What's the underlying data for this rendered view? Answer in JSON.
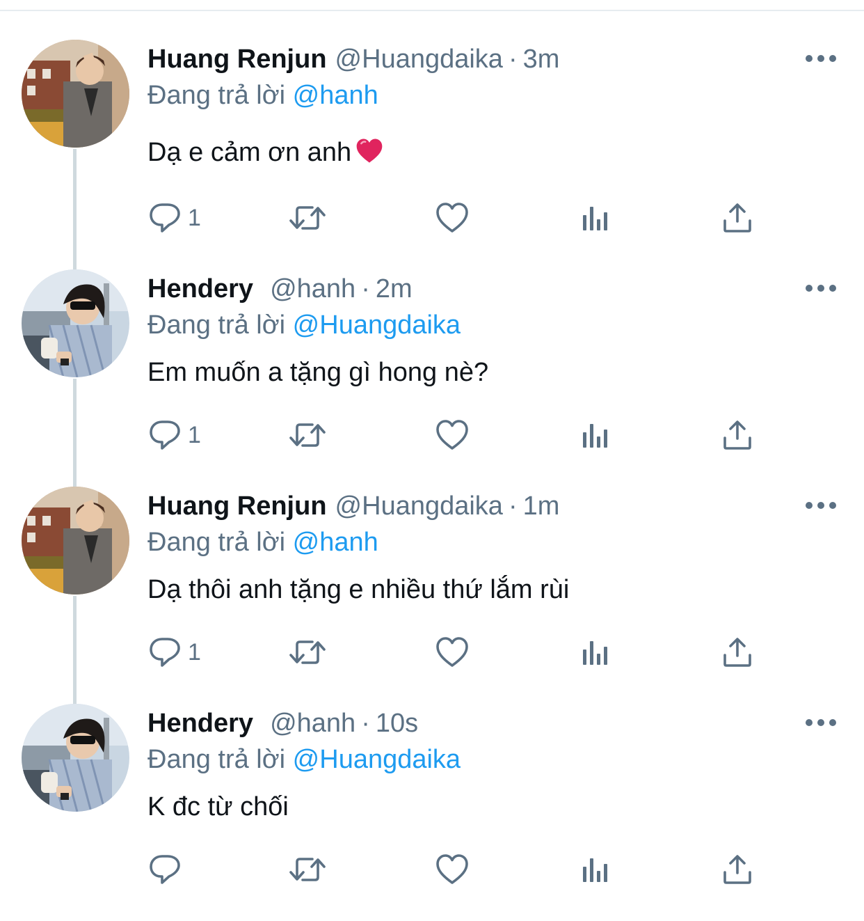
{
  "tweets": [
    {
      "name": "Huang Renjun",
      "handle": "@Huangdaika",
      "separator": "·",
      "time": "3m",
      "reply_prefix": "Đang trả lời",
      "reply_to": "@hanh",
      "text": "Dạ e cảm ơn anh",
      "emoji": "heart-emoji",
      "reply_count": "1",
      "avatar": "renjun"
    },
    {
      "name": "Hendery",
      "handle": "@hanh",
      "separator": "·",
      "time": "2m",
      "reply_prefix": "Đang trả lời",
      "reply_to": "@Huangdaika",
      "text": "Em muốn a tặng gì hong nè?",
      "reply_count": "1",
      "avatar": "hendery"
    },
    {
      "name": "Huang Renjun",
      "handle": "@Huangdaika",
      "separator": "·",
      "time": "1m",
      "reply_prefix": "Đang trả lời",
      "reply_to": "@hanh",
      "text": "Dạ thôi anh tặng e nhiều thứ lắm rùi",
      "reply_count": "1",
      "avatar": "renjun"
    },
    {
      "name": "Hendery",
      "handle": "@hanh",
      "separator": "·",
      "time": "10s",
      "reply_prefix": "Đang trả lời",
      "reply_to": "@Huangdaika",
      "text": "K đc từ chối",
      "reply_count": "",
      "avatar": "hendery"
    }
  ],
  "icons": {
    "reply": "reply-icon",
    "retweet": "retweet-icon",
    "like": "like-icon",
    "analytics": "analytics-icon",
    "share": "share-icon",
    "more": "more-icon"
  },
  "colors": {
    "text_primary": "#0f1419",
    "text_secondary": "#5b7083",
    "mention": "#1d9bf0",
    "thread_line": "#cfd9de",
    "heart": "#e0245e"
  }
}
